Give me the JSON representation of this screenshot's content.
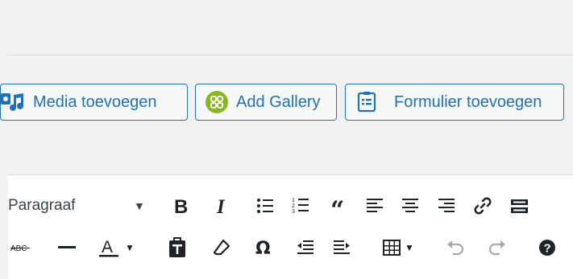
{
  "media_buttons": {
    "media_label": "Media toevoegen",
    "gallery_label": "Add Gallery",
    "form_label": "Formulier toevoegen"
  },
  "toolbar": {
    "format_select": "Paragraaf",
    "row1": [
      "format-select",
      "bold",
      "italic",
      "bullet-list",
      "numbered-list",
      "blockquote",
      "align-left",
      "align-center",
      "align-right",
      "link",
      "toolbar-toggle"
    ],
    "row2": [
      "strikethrough",
      "horizontal-line",
      "text-color",
      "text-color-dropdown",
      "paste-as-text",
      "clear-formatting",
      "special-character",
      "outdent",
      "indent",
      "table",
      "undo",
      "redo",
      "help"
    ]
  },
  "highlighted_tool": "paste-as-text",
  "colors": {
    "accent": "#2271b1",
    "highlight": "#ff0000",
    "gallery_icon": "#8ab626"
  }
}
